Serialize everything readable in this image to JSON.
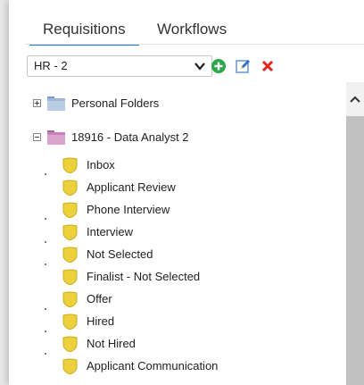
{
  "tabs": [
    {
      "label": "Requisitions",
      "active": true
    },
    {
      "label": "Workflows",
      "active": false
    }
  ],
  "filter": {
    "selected": "HR - 2"
  },
  "actions": {
    "add_icon": "plus-circle-icon",
    "edit_icon": "pencil-icon",
    "delete_icon": "x-icon"
  },
  "tree": {
    "personal_folders": {
      "label": "Personal Folders",
      "expanded": false
    },
    "requisition": {
      "label": "18916 - Data Analyst 2",
      "expanded": true,
      "stages": [
        "Inbox",
        "Applicant Review",
        "Phone Interview",
        "Interview",
        "Not Selected",
        "Finalist - Not Selected",
        "Offer",
        "Hired",
        "Not Hired",
        "Applicant Communication"
      ]
    }
  },
  "colors": {
    "accent": "#1f7ad6",
    "add": "#2aa84a",
    "delete": "#e0251b",
    "folder_blue": "#9db8d9",
    "folder_purple": "#c882b9",
    "stage_yellow": "#ecd13d"
  }
}
